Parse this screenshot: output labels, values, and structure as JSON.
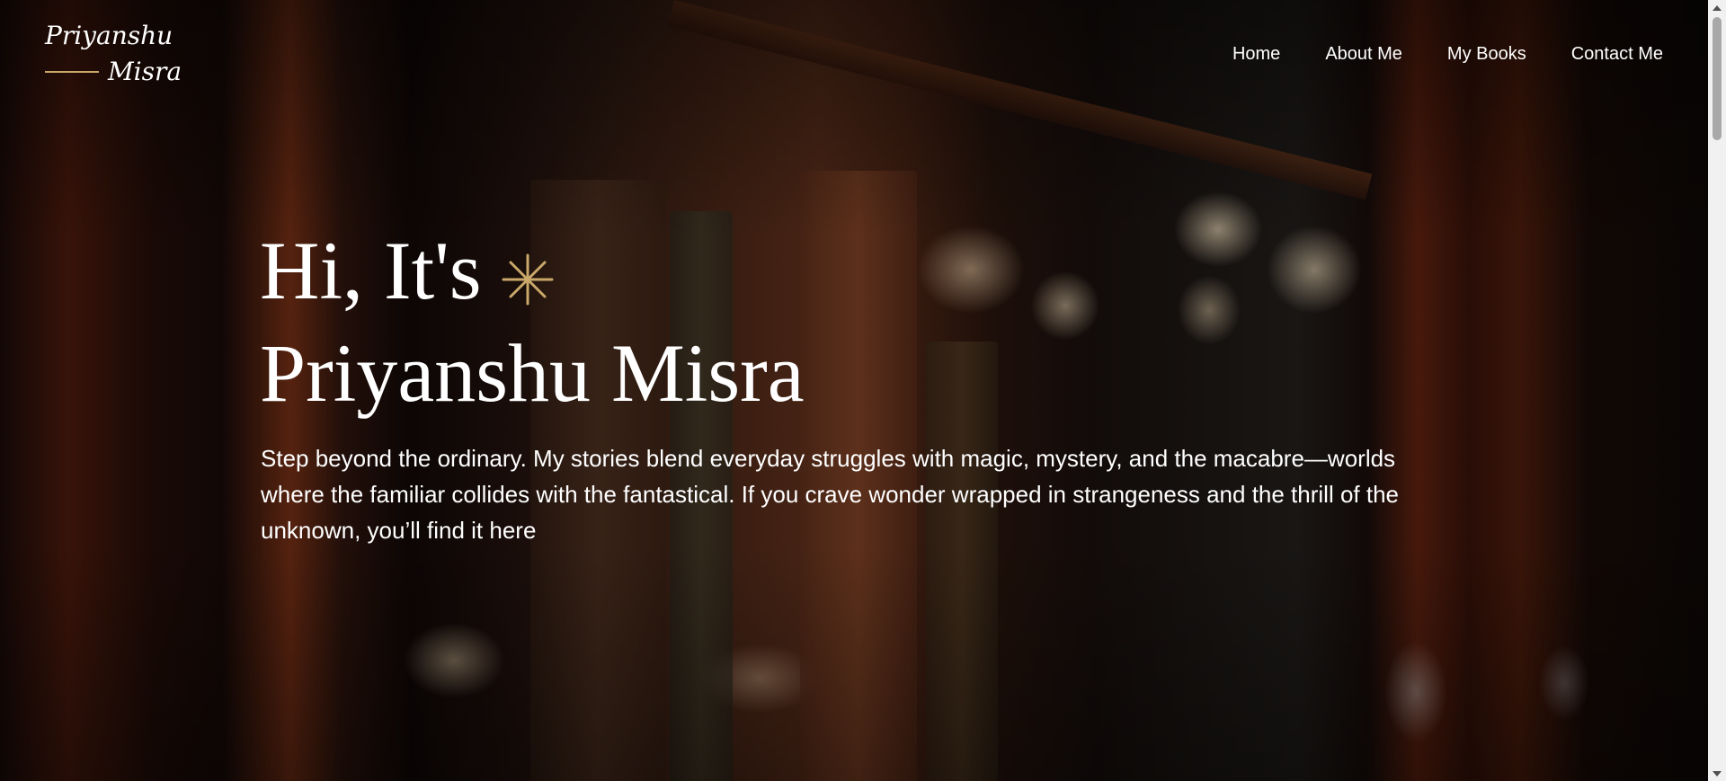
{
  "header": {
    "logo_line1": "Priyanshu",
    "logo_line2": "Misra",
    "nav": [
      "Home",
      "About Me",
      "My Books",
      "Contact Me"
    ]
  },
  "hero": {
    "greeting": "Hi, It's",
    "name": "Priyanshu Misra",
    "description": "Step beyond the ordinary. My stories blend everyday struggles with magic, mystery, and the macabre—worlds where the familiar collides with the fantastical. If you crave wonder wrapped in strangeness and the thrill of the unknown, you’ll find it here",
    "sparkle_icon": "sparkle-icon",
    "background_image": "dark bookshelf with antique books and warm bokeh lights"
  },
  "colors": {
    "accent_gold": "#c9a86a",
    "text": "#ffffff"
  }
}
